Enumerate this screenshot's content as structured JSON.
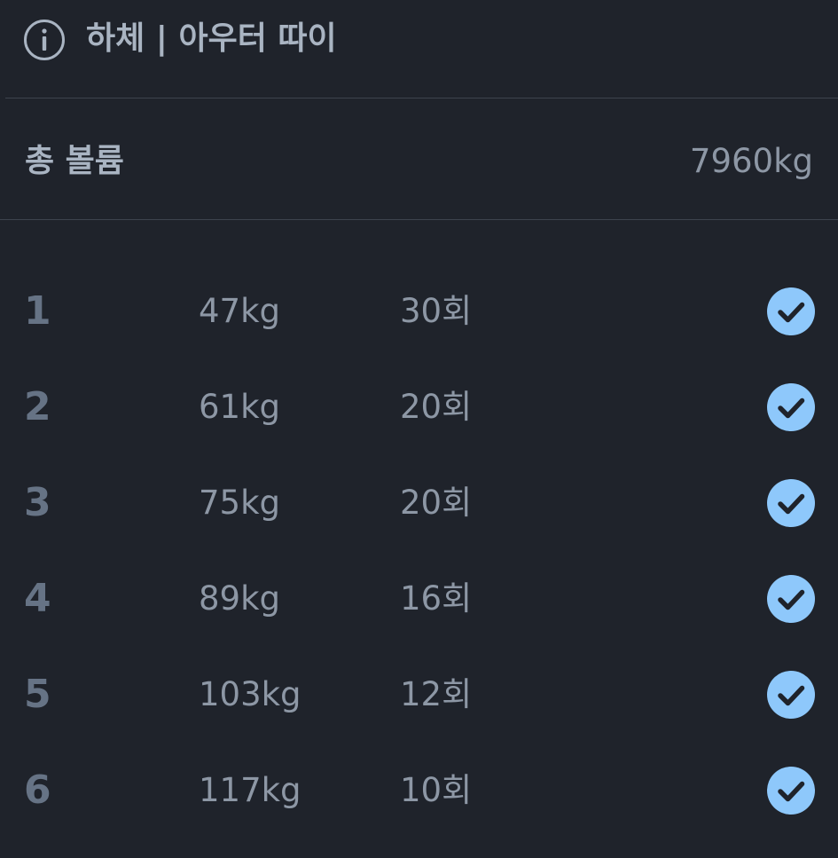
{
  "header": {
    "icon": "info-icon",
    "title": "하체 | 아우터 따이"
  },
  "volume": {
    "label": "총 볼륨",
    "value": "7960kg"
  },
  "sets": [
    {
      "number": "1",
      "weight": "47kg",
      "reps": "30회",
      "completed": true
    },
    {
      "number": "2",
      "weight": "61kg",
      "reps": "20회",
      "completed": true
    },
    {
      "number": "3",
      "weight": "75kg",
      "reps": "20회",
      "completed": true
    },
    {
      "number": "4",
      "weight": "89kg",
      "reps": "16회",
      "completed": true
    },
    {
      "number": "5",
      "weight": "103kg",
      "reps": "12회",
      "completed": true
    },
    {
      "number": "6",
      "weight": "117kg",
      "reps": "10회",
      "completed": true
    }
  ],
  "colors": {
    "background": "#1f232b",
    "check_fill": "#8ec8fb",
    "check_mark": "#1f232b",
    "primary_text": "#a9b4c2",
    "secondary_text": "#8d97a5",
    "set_number": "#667385",
    "divider": "#3d434d"
  },
  "icons": {
    "completed": "check-circle-icon"
  }
}
